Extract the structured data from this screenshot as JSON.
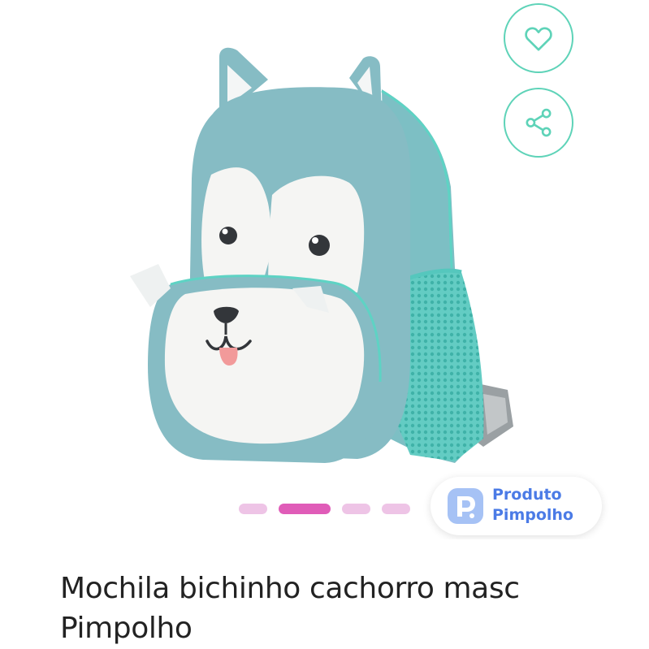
{
  "product": {
    "title": "Mochila bichinho cachorro masc Pimpolho",
    "image_alt": "backpack-image"
  },
  "actions": {
    "favorite_icon": "heart-icon",
    "share_icon": "share-icon"
  },
  "gallery": {
    "slide_count": 4,
    "active_index": 1
  },
  "badge": {
    "line1": "Produto",
    "line2": "Pimpolho",
    "logo_icon": "pimpolho-p-logo"
  },
  "colors": {
    "accent": "#5ed3b8",
    "dot_active": "#e05cb8",
    "dot_inactive": "#eec4e6",
    "badge_text": "#4b7be6",
    "title_text": "#222222"
  }
}
